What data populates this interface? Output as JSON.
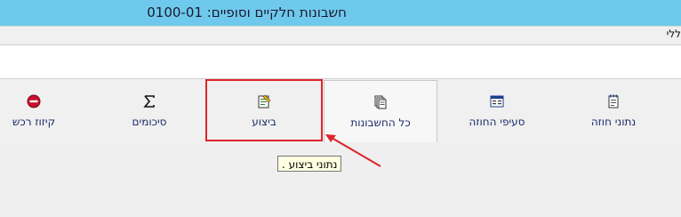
{
  "window": {
    "title": "חשבונות חלקיים וסופיים: 0100-01"
  },
  "subbar": {
    "label": "ללי"
  },
  "tabs": [
    {
      "label": "קיזוז רכש",
      "icon": "no-entry-icon"
    },
    {
      "label": "סיכומים",
      "icon": "sigma-icon"
    },
    {
      "label": "ביצוע",
      "icon": "execution-icon"
    },
    {
      "label": "כל החשבונות",
      "icon": "documents-icon"
    },
    {
      "label": "סעיפי החוזה",
      "icon": "window-list-icon"
    },
    {
      "label": "נתוני חוזה",
      "icon": "notepad-icon"
    }
  ],
  "tooltip": {
    "text": "נתוני ביצוע ."
  },
  "colors": {
    "titlebar": "#6fc9ec",
    "highlight": "#e0242a",
    "tab_label": "#1b2a6b",
    "tooltip_bg": "#ffffe1"
  }
}
